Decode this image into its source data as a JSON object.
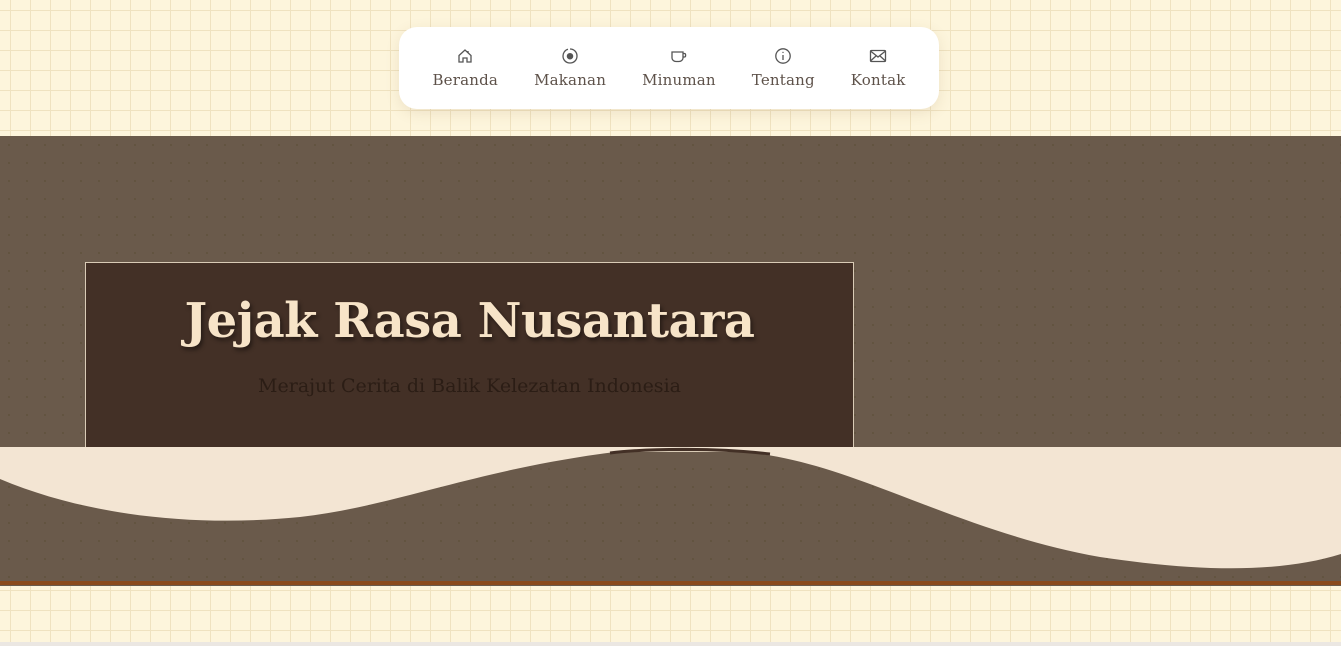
{
  "nav": {
    "items": [
      {
        "label": "Beranda",
        "icon": "home-icon"
      },
      {
        "label": "Makanan",
        "icon": "food-icon"
      },
      {
        "label": "Minuman",
        "icon": "cup-icon"
      },
      {
        "label": "Tentang",
        "icon": "info-icon"
      },
      {
        "label": "Kontak",
        "icon": "mail-icon"
      }
    ]
  },
  "hero": {
    "title": "Jejak Rasa Nusantara",
    "subtitle": "Merajut Cerita di Balik Kelezatan Indonesia"
  },
  "colors": {
    "page_bg": "#fdf5dc",
    "hero_bg": "#6a5a4b",
    "title_box_bg": "#433026",
    "title_text": "#f7e4c8",
    "wave_fill": "#f3e5d3",
    "accent_line": "#8a4a1c"
  }
}
